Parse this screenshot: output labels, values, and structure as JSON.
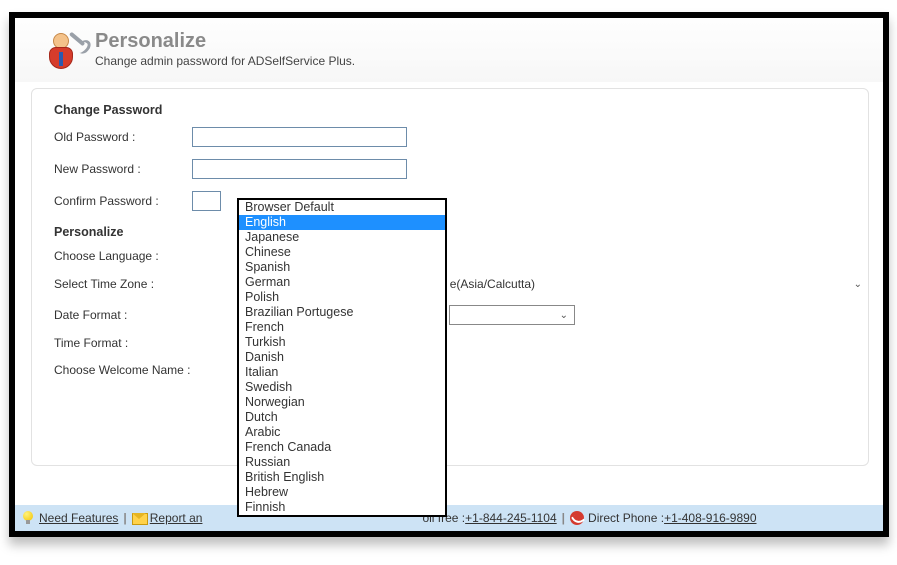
{
  "header": {
    "title": "Personalize",
    "subtitle": "Change admin password for ADSelfService Plus."
  },
  "password": {
    "section_title": "Change Password",
    "old_label": "Old Password :",
    "new_label": "New Password :",
    "confirm_label": "Confirm Password :",
    "old_value": "",
    "new_value": "",
    "confirm_value": ""
  },
  "personalize": {
    "section_title": "Personalize",
    "language_label": "Choose Language :",
    "timezone_label": "Select Time Zone :",
    "timezone_value_visible": "e(Asia/Calcutta)",
    "dateformat_label": "Date Format :",
    "timeformat_label": "Time Format :",
    "welcomename_label": "Choose Welcome Name :"
  },
  "language_options": [
    "Browser Default",
    "English",
    "Japanese",
    "Chinese",
    "Spanish",
    "German",
    "Polish",
    "Brazilian Portugese",
    "French",
    "Turkish",
    "Danish",
    "Italian",
    "Swedish",
    "Norwegian",
    "Dutch",
    "Arabic",
    "French Canada",
    "Russian",
    "British English",
    "Hebrew",
    "Finnish"
  ],
  "language_selected_index": 1,
  "footer": {
    "need_features": "Need Features",
    "report_an": "Report an",
    "tollfree_prefix": "oll free : ",
    "tollfree_number": "+1-844-245-1104",
    "direct_prefix": " Direct Phone : ",
    "direct_number": "+1-408-916-9890"
  }
}
